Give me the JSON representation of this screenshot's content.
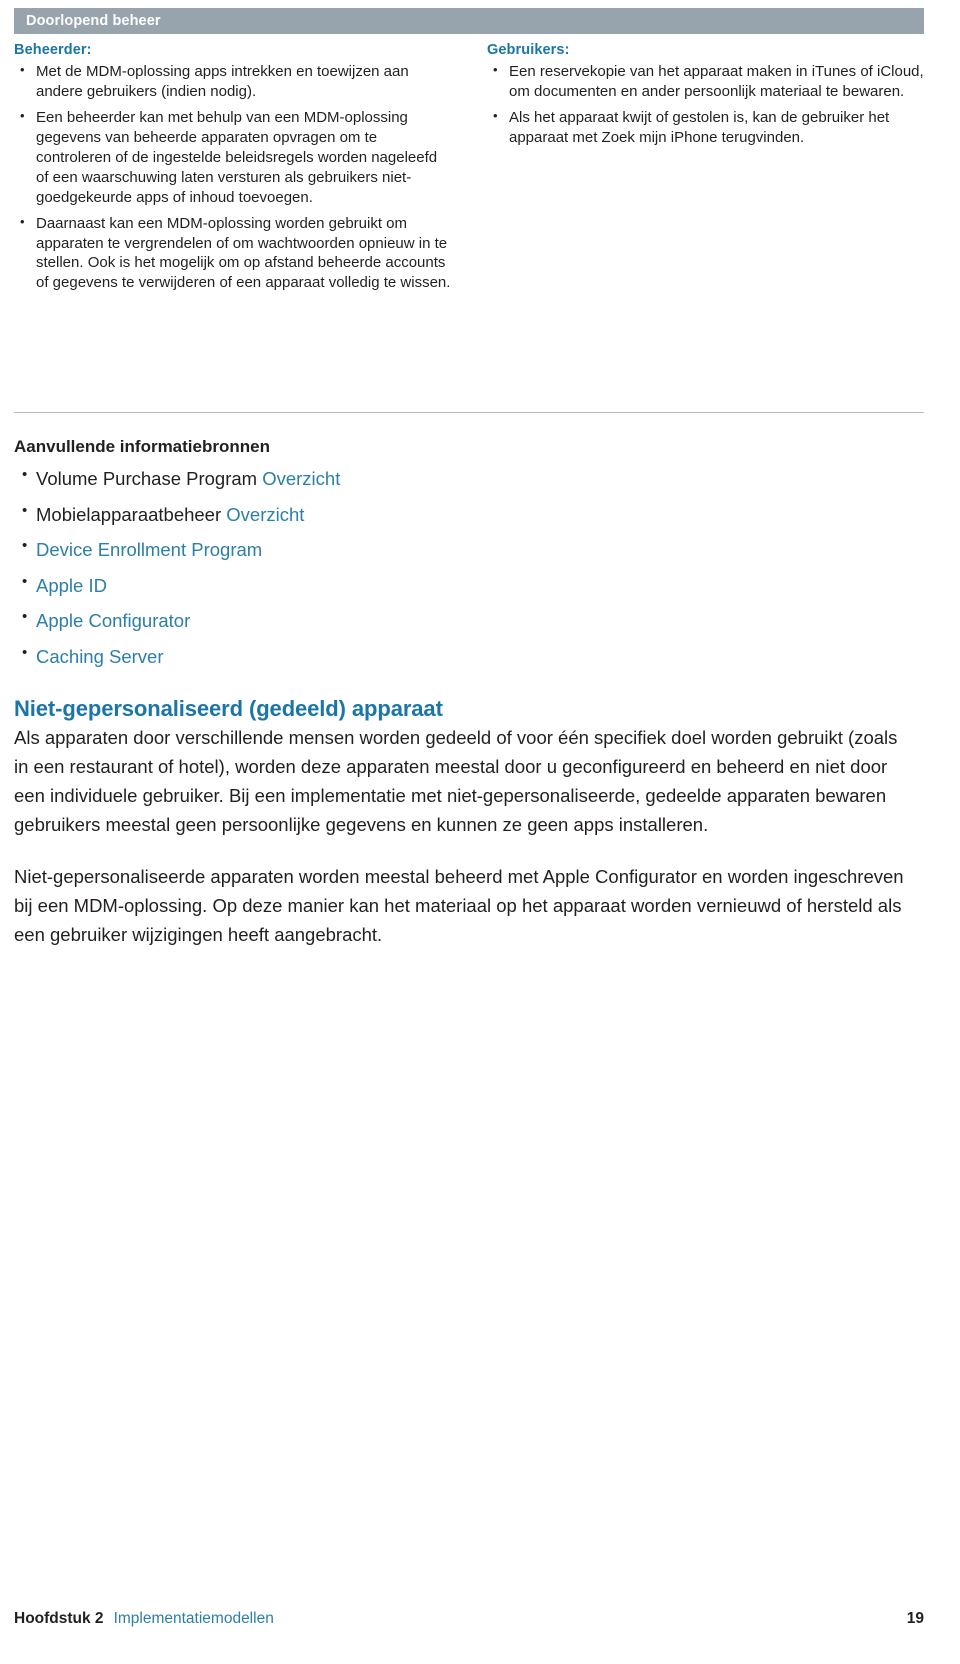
{
  "banner": {
    "title": "Doorlopend beheer"
  },
  "columns": [
    {
      "label": "Beheerder:",
      "bullets": [
        "Met de MDM-oplossing apps intrekken en toewijzen aan andere gebruikers (indien nodig).",
        "Een beheerder kan met behulp van een MDM-oplossing gegevens van beheerde apparaten opvragen om te controleren of de ingestelde beleidsregels worden nageleefd of een waarschuwing laten versturen als gebruikers niet-goedgekeurde apps of inhoud toevoegen.",
        "Daarnaast kan een MDM-oplossing worden gebruikt om apparaten te vergrendelen of om wachtwoorden opnieuw in te stellen. Ook is het mogelijk om op afstand beheerde accounts of gegevens te verwijderen of een apparaat volledig te wissen."
      ]
    },
    {
      "label": "Gebruikers:",
      "bullets": [
        "Een reservekopie van het apparaat maken in iTunes of iCloud, om documenten en ander persoonlijk materiaal te bewaren.",
        "Als het apparaat kwijt of gestolen is, kan de gebruiker het apparaat met Zoek mijn iPhone terugvinden."
      ]
    }
  ],
  "resources": {
    "title": "Aanvullende informatiebronnen",
    "items": [
      {
        "text": "Volume Purchase Program ",
        "link": "Overzicht"
      },
      {
        "text": "Mobielapparaatbeheer ",
        "link": "Overzicht"
      },
      {
        "text": "",
        "link": "Device Enrollment Program"
      },
      {
        "text": "",
        "link": "Apple ID"
      },
      {
        "text": "",
        "link": "Apple Configurator"
      },
      {
        "text": "",
        "link": "Caching Server"
      }
    ]
  },
  "section": {
    "heading": "Niet-gepersonaliseerd (gedeeld) apparaat",
    "paragraphs": [
      "Als apparaten door verschillende mensen worden gedeeld of voor één specifiek doel worden gebruikt (zoals in een restaurant of hotel), worden deze apparaten meestal door u geconfigureerd en beheerd en niet door een individuele gebruiker. Bij een implementatie met niet-gepersonaliseerde, gedeelde apparaten bewaren gebruikers meestal geen persoonlijke gegevens en kunnen ze geen apps installeren.",
      "Niet-gepersonaliseerde apparaten worden meestal beheerd met Apple Configurator en worden ingeschreven bij een MDM-oplossing. Op deze manier kan het materiaal op het apparaat worden vernieuwd of hersteld als een gebruiker wijzigingen heeft aangebracht."
    ]
  },
  "footer": {
    "chapter": "Hoofdstuk 2",
    "section": "Implementatiemodellen",
    "page": "19"
  },
  "colors": {
    "banner_bg": "#97a3ad",
    "accent_blue": "#1b76a8",
    "link_blue": "#2c7fa6",
    "body_text": "#231f20",
    "rule": "#b9bcbe"
  }
}
